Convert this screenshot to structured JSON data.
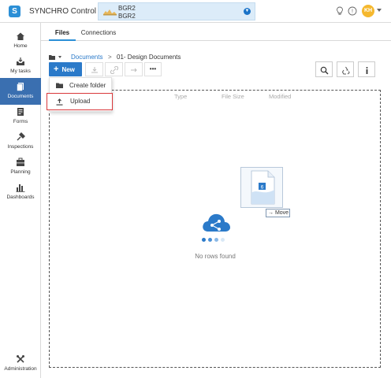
{
  "header": {
    "logo_glyph": "S",
    "app_title": "SYNCHRO Control",
    "project": {
      "line1": "BGR2",
      "line2": "BGR2"
    },
    "avatar_initials": "KH",
    "icons": [
      "lightbulb-icon",
      "help-icon"
    ]
  },
  "sidebar": {
    "items": [
      {
        "label": "Home",
        "icon": "home-icon"
      },
      {
        "label": "My tasks",
        "icon": "inbox-icon"
      },
      {
        "label": "Documents",
        "icon": "documents-icon",
        "active": true
      },
      {
        "label": "Forms",
        "icon": "forms-icon"
      },
      {
        "label": "Inspections",
        "icon": "inspections-icon"
      },
      {
        "label": "Planning",
        "icon": "planning-icon"
      },
      {
        "label": "Dashboards",
        "icon": "dashboards-icon"
      },
      {
        "label": "Administration",
        "icon": "tools-icon"
      }
    ]
  },
  "tabs": {
    "files": "Files",
    "connections": "Connections"
  },
  "breadcrumb": {
    "root": "Documents",
    "separator": ">",
    "current": "01- Design Documents"
  },
  "toolbar": {
    "new_label": "New",
    "new_plus": "+",
    "more_label": "•••"
  },
  "menu": {
    "create_folder": "Create folder",
    "upload": "Upload"
  },
  "grid": {
    "columns": [
      "Type",
      "File Size",
      "Modified"
    ],
    "empty_text": "No rows found"
  },
  "drag": {
    "move_label": "→ Move",
    "file_badge": "6"
  },
  "colors": {
    "accent": "#2b7ac9",
    "sidebar_active": "#3a6fb0",
    "highlight_border": "#d9383b",
    "avatar": "#f5b82e"
  }
}
